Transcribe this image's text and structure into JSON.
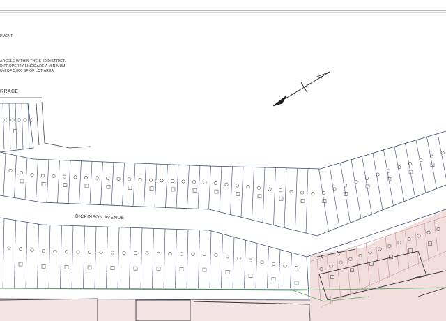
{
  "notes": {
    "line_1": "PMENT",
    "line_2": "ARCELS WITHIN THE S-50 DISTRICT.",
    "line_3": "D PROPERTY LINES ARE A MINIMUM",
    "line_4": "UM OF 5,000 SF OF LOT AREA."
  },
  "streets": {
    "terrace": "RRACE",
    "dickinson": "DICKINSON AVENUE"
  },
  "colors": {
    "lot_line": "#3a4a6a",
    "shaded_lot": "#f3dede",
    "shaded_line": "#c89a9a",
    "green_line": "#5aa865",
    "dark_line": "#333333"
  },
  "icons": {
    "north_arrow": "north-arrow-icon",
    "tree": "tree-icon",
    "house": "house-footprint-icon"
  }
}
